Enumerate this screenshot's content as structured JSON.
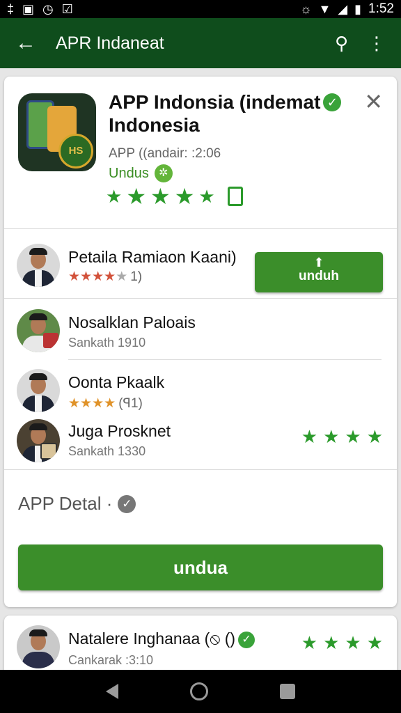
{
  "status_bar": {
    "left_icons": [
      "‡",
      "▣",
      "◷",
      "☑"
    ],
    "time": "1:52",
    "right_icons": [
      "☼",
      "▼",
      "◢",
      "▮"
    ]
  },
  "app_bar": {
    "title": "APR Indaneat",
    "back_icon": "←",
    "search_icon": "⚲",
    "more_icon": "⋮"
  },
  "app": {
    "title": "APP Indonsia (indemat",
    "title_line2": "Indonesia",
    "subtitle": "APP ((andair: :2:06",
    "status_label": "Undus",
    "rating_stars": [
      "★",
      "★",
      "★",
      "★",
      "★"
    ],
    "icon_badge_text": "HS",
    "close_icon": "✕",
    "verified_mark": "✓",
    "status_icon_glyph": "✲"
  },
  "rows": [
    {
      "name": "Petaila Ramiaon Kaani)",
      "stars": [
        "★",
        "★",
        "★",
        "★"
      ],
      "grey_star": "★",
      "count": "1)",
      "button_label": "unduh",
      "button_icon": "⬆"
    },
    {
      "name": "Nosalklan Paloais",
      "sub": "Sankath 1910"
    },
    {
      "name": "Oonta Pkaalk",
      "stars": [
        "★",
        "★",
        "★",
        "★"
      ],
      "count": "(ꟼ1)"
    },
    {
      "name": "Juga Prosknet",
      "sub": "Sankath 1330",
      "right_stars": [
        "★",
        "★",
        "★",
        "★"
      ]
    }
  ],
  "detail": {
    "title": "APP Detal ·",
    "check_mark": "✓",
    "button_label": "undua"
  },
  "bottom_row": {
    "name": "Natalere Inghanaa (",
    "name_suffix": "⦸ ()",
    "verified_mark": "✓",
    "sub": "Cankarak :3:10",
    "right_stars": [
      "★",
      "★",
      "★",
      "★"
    ]
  },
  "colors": {
    "app_bar": "#0f4d1c",
    "accent_green": "#3b8e2a",
    "star_green": "#2b9a2b",
    "star_orange": "#e0932a"
  }
}
